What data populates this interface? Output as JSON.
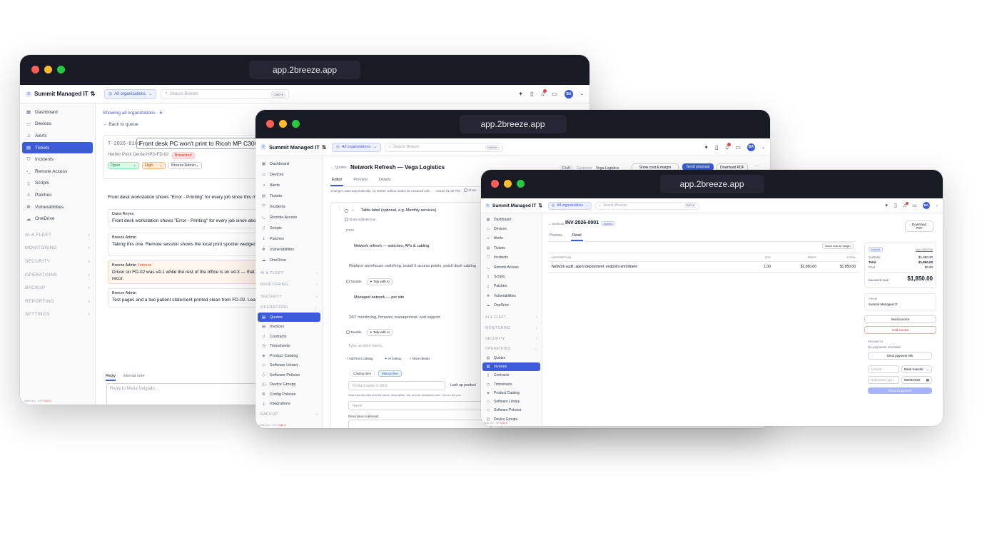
{
  "url": "app.2breeze.app",
  "brand": "Summit Managed IT",
  "brand_icon": "≡",
  "org_selector": "All organizations",
  "search_placeholder": "Search Breeze",
  "kbd": "CMD+K",
  "avatar": "BA",
  "sidebar_nav": [
    "Dashboard",
    "Devices",
    "Alerts",
    "Tickets",
    "Incidents",
    "Remote Access",
    "Scripts",
    "Patches",
    "Vulnerabilities",
    "OneDrive"
  ],
  "sidebar_sections": [
    "AI & FLEET",
    "MONITORING",
    "SECURITY",
    "OPERATIONS",
    "BACKUP",
    "REPORTING",
    "SETTINGS"
  ],
  "operations_items": [
    "Quotes",
    "Invoices",
    "Contracts",
    "Timesheets",
    "Product Catalog",
    "Software Library",
    "Software Policies",
    "Device Groups",
    "Config Policies",
    "Integrations"
  ],
  "version": "Web dev · API",
  "version_tag": "0.82.0",
  "colors": {
    "accent": "#3b5bdb",
    "titlebar": "#181a24",
    "danger": "#ef4444"
  },
  "ticket": {
    "showing": "Showing all organizations · 6",
    "back": "← Back to queue",
    "id": "T-2026-0101",
    "title": "Front desk PC won't print to Ricoh MP C3004",
    "org": "Harbor Point Dental",
    "device": "HPD-FD-02",
    "breached": "Breached",
    "status": "Open",
    "priority": "High",
    "assignee": "Breeze Admin",
    "description": "Front desk workstation shows \"Error - Printing\" for every job since this morni",
    "messages": [
      {
        "author": "Dana Reyes",
        "tag": "",
        "text": "Front desk workstation shows \"Error - Printing\" for every job since about 8"
      },
      {
        "author": "Breeze Admin",
        "tag": "",
        "text": "Taking this one. Remote session shows the local print spooler wedged on a"
      },
      {
        "author": "Breeze Admin",
        "tag": "Internal",
        "text": "Driver on FD-02 was v4.1 while the rest of the office is on v4.3 — that misma",
        "text2": "recur."
      },
      {
        "author": "Breeze Admin",
        "tag": "",
        "text": "Test pages and a live patient statement printed clean from FD-02. Leaving"
      }
    ],
    "reply_tab": "Reply",
    "note_tab": "Internal note",
    "reply_placeholder": "Reply to Maria Delgado..."
  },
  "quote": {
    "back": "← Quotes",
    "title": "Network Refresh — Vega Logistics",
    "draft": "Draft",
    "customer_label": "Customer",
    "customer": "Vega Logistics",
    "show_cost": "Show cost & margin",
    "send": "Send proposal",
    "download": "Download PDF",
    "more": "···",
    "tabs": [
      "Editor",
      "Preview",
      "Details"
    ],
    "autosave": "Changes save automatically. An amber outline marks an unsaved edit.",
    "saved": "Saved 01:42 PM",
    "show_more": "Show",
    "table_label": "Table label (optional, e.g. Monthly services)",
    "show_subtotal": "Show subtotal row",
    "item_header": "ITEM",
    "items": [
      {
        "name": "Network refresh — switches, APs & cabling",
        "desc": "Replace warehouse switching, install 6 access points, patch dock cabling"
      },
      {
        "name": "Managed network — per site",
        "desc": "24/7 monitoring, firmware management, and support"
      }
    ],
    "taxable": "Taxable",
    "tidy": "Tidy with AI",
    "new_item_placeholder": "Type an item name...",
    "add_catalog": "Add from catalog",
    "ai_lookup": "AI lookup",
    "more_details": "More details",
    "catalog_tab": "Catalog item",
    "manual_tab": "Manual line",
    "product_placeholder": "Product name or SKU",
    "lookup": "Look up product",
    "lookup_help": "Searches the web and fills name, description, tax, and an estimated cost. You set the pric",
    "name_placeholder": "Name",
    "desc_label": "Description (optional)"
  },
  "invoice": {
    "back": "← Invoices",
    "number": "INV-2026-0001",
    "status": "Issued",
    "download": "Download PDF",
    "tabs": [
      "Preview",
      "Detail"
    ],
    "show_cost": "Show cost & margin",
    "columns": [
      "DESCRIPTION",
      "QTY",
      "PRICE",
      "TOTAL"
    ],
    "line": {
      "desc": "Network audit, agent deployment, endpoint enrollment",
      "qty": "1.00",
      "price": "$1,850.00",
      "total": "$1,850.00"
    },
    "due": "Due 9/8/2026",
    "subtotal_label": "Subtotal",
    "subtotal": "$1,850.00",
    "total_label": "Total",
    "total": "$1,850.00",
    "paid_label": "Paid",
    "paid": "$0.00",
    "balance_label": "BALANCE DUE",
    "balance": "$1,850.00",
    "from_label": "FROM",
    "from": "Summit Managed IT",
    "send": "Send invoice",
    "void": "Void invoice",
    "payments_label": "PAYMENTS",
    "no_payments": "No payments recorded.",
    "payment_link": "Send payment link",
    "amount_placeholder": "Amount",
    "method": "Bank transfer",
    "reference_placeholder": "Reference (opt.)",
    "date": "08/09/2026",
    "record": "Record payment"
  }
}
